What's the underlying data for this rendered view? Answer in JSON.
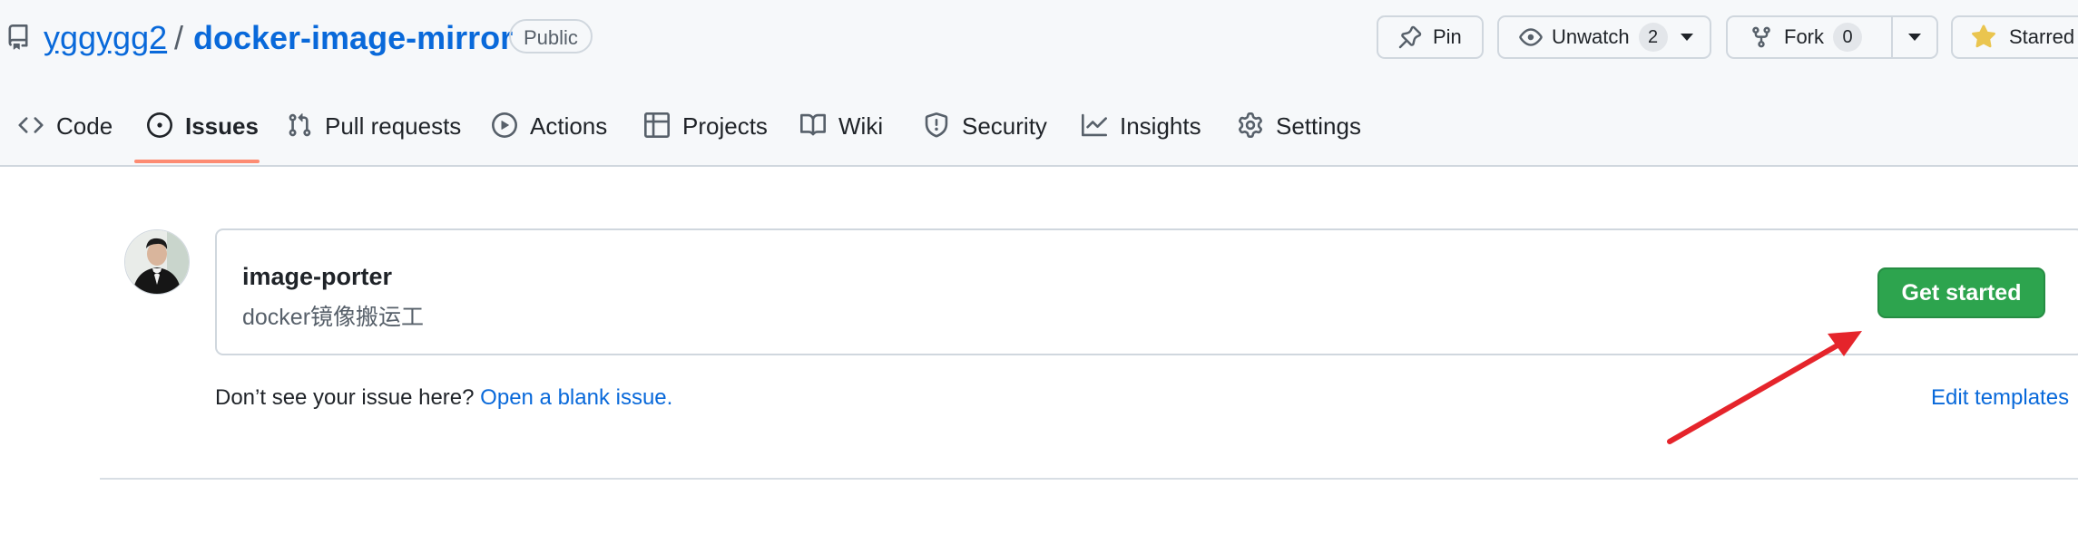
{
  "repo": {
    "owner": "yggygg2",
    "separator": "/",
    "name": "docker-image-mirror",
    "visibility": "Public"
  },
  "actions": {
    "pin": "Pin",
    "unwatch": "Unwatch",
    "watch_count": "2",
    "fork": "Fork",
    "fork_count": "0",
    "starred": "Starred"
  },
  "tabs": [
    {
      "label": "Code",
      "icon": "code-icon"
    },
    {
      "label": "Issues",
      "icon": "issue-opened-icon",
      "active": true
    },
    {
      "label": "Pull requests",
      "icon": "git-pull-request-icon"
    },
    {
      "label": "Actions",
      "icon": "play-icon"
    },
    {
      "label": "Projects",
      "icon": "table-icon"
    },
    {
      "label": "Wiki",
      "icon": "book-icon"
    },
    {
      "label": "Security",
      "icon": "shield-icon"
    },
    {
      "label": "Insights",
      "icon": "graph-icon"
    },
    {
      "label": "Settings",
      "icon": "gear-icon"
    }
  ],
  "template": {
    "name": "image-porter",
    "description": "docker镜像搬运工",
    "button": "Get started"
  },
  "footer": {
    "prompt": "Don’t see your issue here?",
    "blank_link": "Open a blank issue.",
    "edit_link": "Edit templates"
  },
  "colors": {
    "accent": "#0969da",
    "primary_button": "#2da44e",
    "tab_underline": "#fd8c73",
    "star": "#eac54f",
    "annotation_arrow": "#e5242b"
  }
}
